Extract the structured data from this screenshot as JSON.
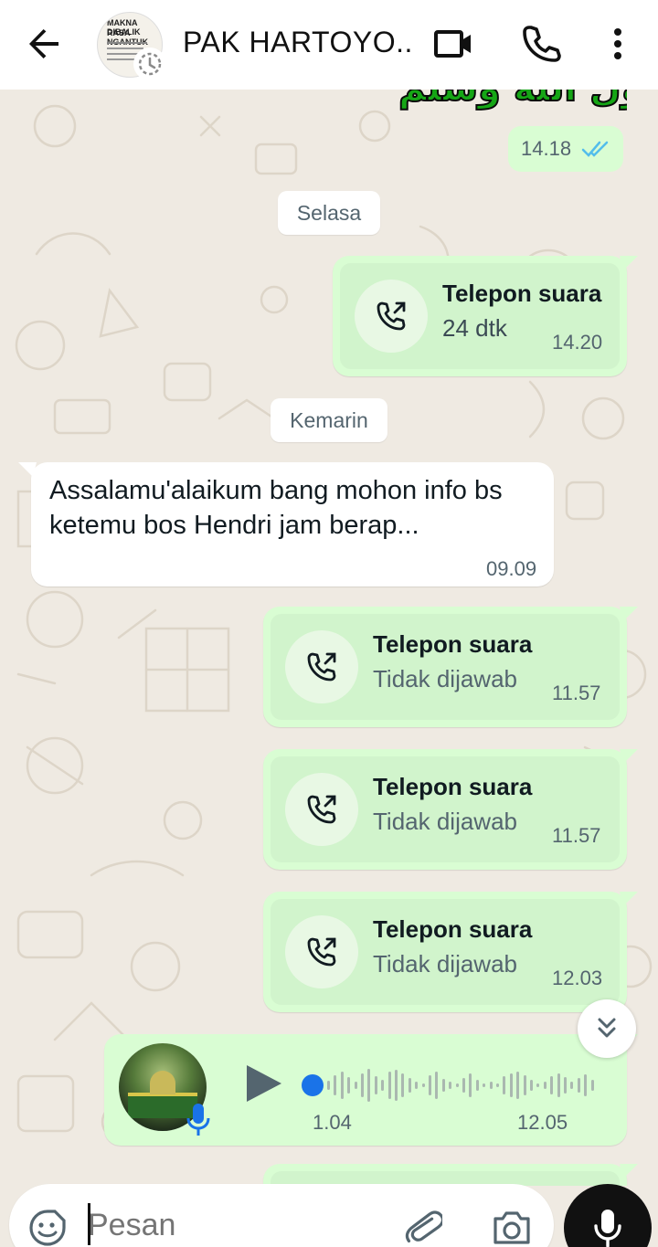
{
  "header": {
    "contact_name": "PAK HARTOYO...",
    "avatar_text_line1": "MAKNA DIBALIK",
    "avatar_text_line2": "RASA NGANTUK"
  },
  "top_message": {
    "sticker_text": "رسول الله وسلم",
    "time": "14.18",
    "ticks": "double-blue"
  },
  "dates": {
    "selasa": "Selasa",
    "kemarin": "Kemarin"
  },
  "calls": [
    {
      "title": "Telepon suara",
      "subtitle": "24 dtk",
      "time": "14.20"
    },
    {
      "title": "Telepon suara",
      "subtitle": "Tidak dijawab",
      "time": "11.57"
    },
    {
      "title": "Telepon suara",
      "subtitle": "Tidak dijawab",
      "time": "11.57"
    },
    {
      "title": "Telepon suara",
      "subtitle": "Tidak dijawab",
      "time": "12.03"
    }
  ],
  "incoming": {
    "text": "Assalamu'alaikum bang mohon info bs ketemu bos Hendri jam berap...",
    "time": "09.09"
  },
  "voice": {
    "duration": "1.04",
    "time": "12.05",
    "progress": 0.0
  },
  "input": {
    "placeholder": "Pesan"
  },
  "colors": {
    "outgoing_bubble": "#d9fdd3",
    "accent_blue": "#1a73e8",
    "tick_blue": "#53bdeb"
  }
}
